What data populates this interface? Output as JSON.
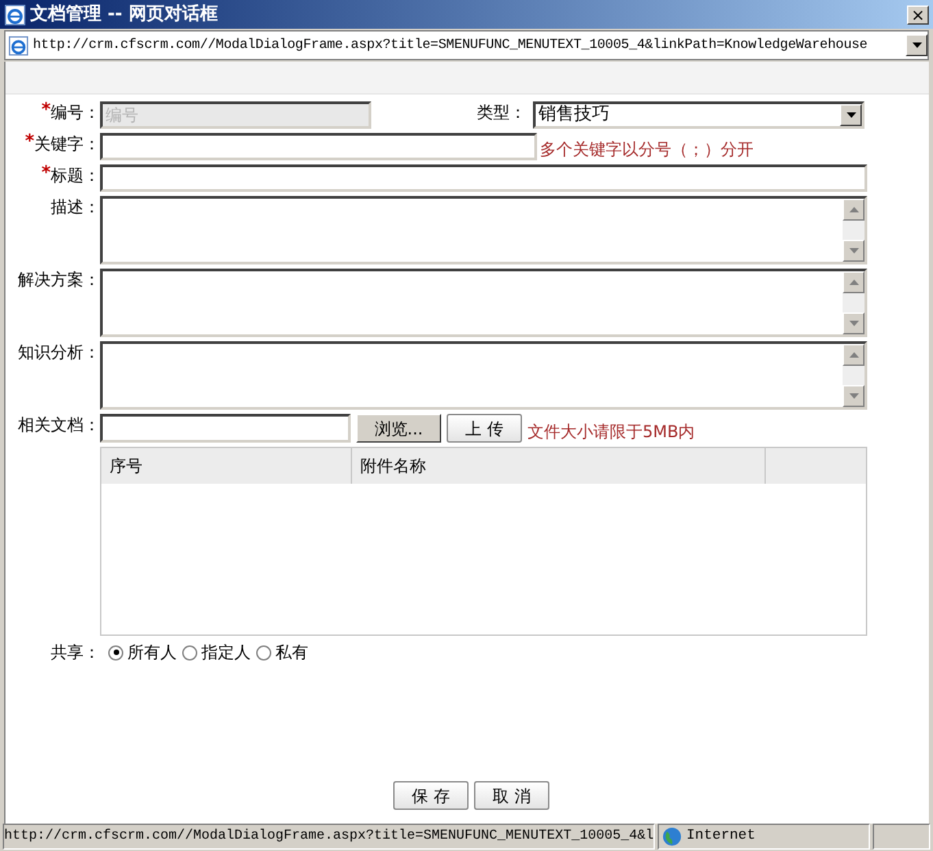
{
  "window": {
    "title": "文档管理 -- 网页对话框",
    "close": "×"
  },
  "address_bar": {
    "url": "http://crm.cfscrm.com//ModalDialogFrame.aspx?title=SMENUFUNC_MENUTEXT_10005_4&linkPath=KnowledgeWarehouse"
  },
  "form": {
    "number": {
      "label": "编号：",
      "required_mark": "*",
      "placeholder": "编号",
      "disabled": true
    },
    "type": {
      "label": "类型：",
      "value": "销售技巧"
    },
    "keywords": {
      "label": "关键字：",
      "required_mark": "*",
      "hint": "多个关键字以分号（；）分开"
    },
    "title": {
      "label": "标题：",
      "required_mark": "*"
    },
    "textareas": [
      {
        "label": "描述："
      },
      {
        "label": "解决方案："
      },
      {
        "label": "知识分析："
      }
    ],
    "attachment": {
      "label": "相关文档：",
      "browse": "浏览...",
      "upload": "上 传",
      "hint": "文件大小请限于5MB内"
    },
    "table": {
      "columns": [
        "序号",
        "附件名称"
      ]
    },
    "share": {
      "label": "共享：",
      "options": [
        {
          "label": "所有人",
          "selected": true
        },
        {
          "label": "指定人",
          "selected": false
        },
        {
          "label": "私有",
          "selected": false
        }
      ]
    }
  },
  "buttons": [
    "保 存",
    "取 消"
  ],
  "status_bar": {
    "url": "http://crm.cfscrm.com//ModalDialogFrame.aspx?title=SMENUFUNC_MENUTEXT_10005_4&l",
    "zone": "Internet"
  }
}
